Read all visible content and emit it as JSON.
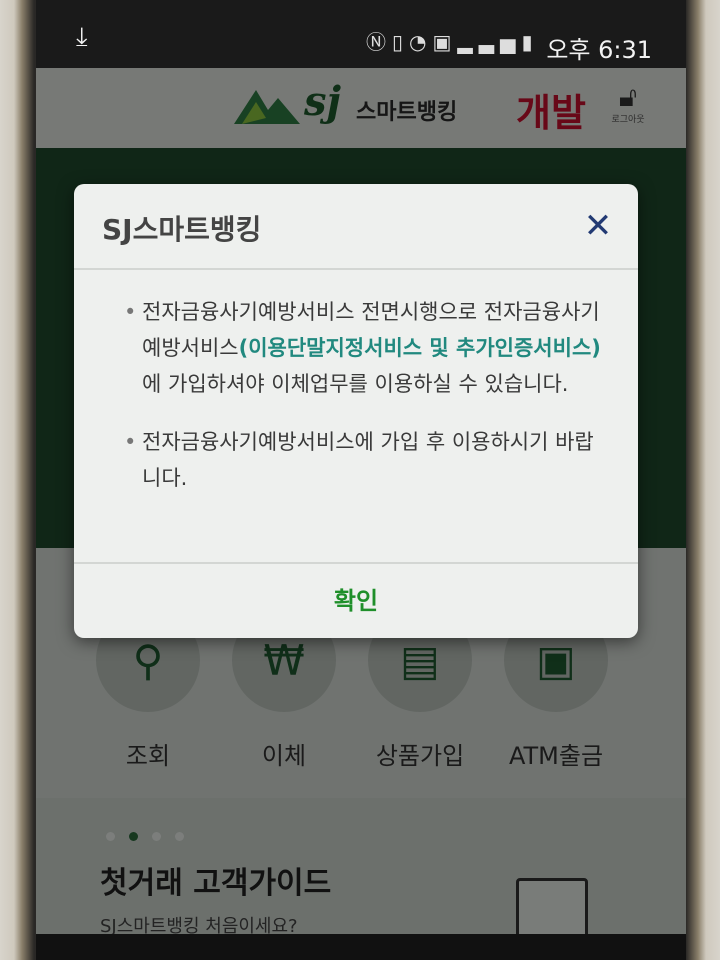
{
  "status_bar": {
    "download_icon": "download-icon",
    "icons": [
      "nfc-icon",
      "vibrate-icon",
      "wifi-icon",
      "sim-icon",
      "signal-icon",
      "battery-icon"
    ],
    "time": "오후 6:31"
  },
  "header": {
    "logo_sj": "sj",
    "logo_text": "스마트뱅킹",
    "env_badge": "개발",
    "logout_label": "로그아웃"
  },
  "menu": {
    "items": [
      {
        "label": "조회",
        "icon": "search-icon"
      },
      {
        "label": "이체",
        "icon": "won-transfer-icon"
      },
      {
        "label": "상품가입",
        "icon": "newspaper-icon"
      },
      {
        "label": "ATM출금",
        "icon": "atm-icon"
      }
    ]
  },
  "guide": {
    "title": "첫거래 고객가이드",
    "subtitle": "SJ스마트뱅킹 처음이세요?"
  },
  "dialog": {
    "title": "SJ스마트뱅킹",
    "close_icon": "close-icon",
    "notice1_pre": "전자금융사기예방서비스 전면시행으로 전자금융사기예방서비스",
    "notice1_highlight": "(이용단말지정서비스 및 추가인증서비스)",
    "notice1_post": "에 가입하셔야 이체업무를 이용하실 수 있습니다.",
    "notice2": "전자금융사기예방서비스에 가입 후 이용하시기 바랍니다.",
    "confirm_label": "확인"
  },
  "colors": {
    "brand_green": "#1f5a31",
    "highlight": "#21897f",
    "confirm": "#1f8f2a",
    "dev_badge": "#c8102e",
    "close": "#223a73"
  }
}
